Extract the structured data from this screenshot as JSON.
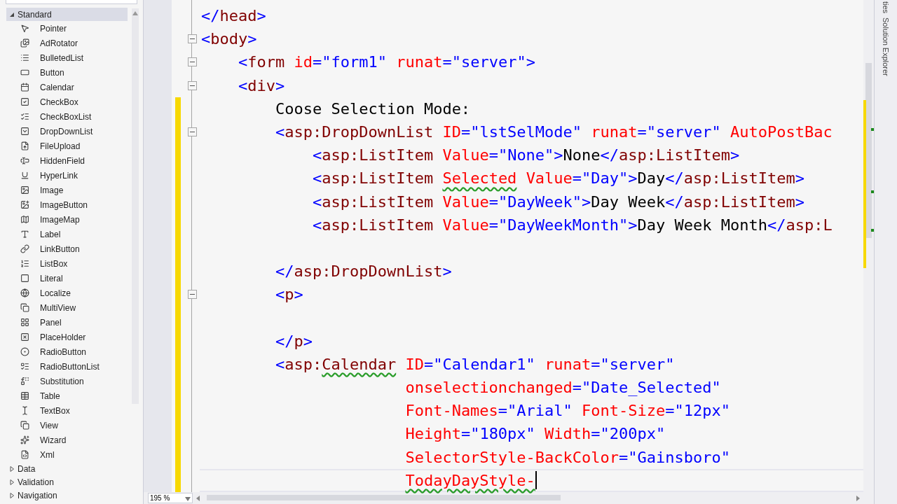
{
  "toolbox": {
    "groups": [
      {
        "label": "Standard",
        "expanded": true,
        "selected": true,
        "items": [
          "Pointer",
          "AdRotator",
          "BulletedList",
          "Button",
          "Calendar",
          "CheckBox",
          "CheckBoxList",
          "DropDownList",
          "FileUpload",
          "HiddenField",
          "HyperLink",
          "Image",
          "ImageButton",
          "ImageMap",
          "Label",
          "LinkButton",
          "ListBox",
          "Literal",
          "Localize",
          "MultiView",
          "Panel",
          "PlaceHolder",
          "RadioButton",
          "RadioButtonList",
          "Substitution",
          "Table",
          "TextBox",
          "View",
          "Wizard",
          "Xml"
        ]
      },
      {
        "label": "Data",
        "expanded": false,
        "selected": false
      },
      {
        "label": "Validation",
        "expanded": false,
        "selected": false
      },
      {
        "label": "Navigation",
        "expanded": false,
        "selected": false
      }
    ]
  },
  "editor": {
    "zoom": "195 %",
    "lines": [
      {
        "foldable": false,
        "modified": false,
        "tokens": [
          {
            "kind": "delimiter",
            "text": "</"
          },
          {
            "kind": "element",
            "text": "head"
          },
          {
            "kind": "delimiter",
            "text": ">"
          }
        ]
      },
      {
        "foldable": true,
        "modified": false,
        "tokens": [
          {
            "kind": "delimiter",
            "text": "<"
          },
          {
            "kind": "element",
            "text": "body"
          },
          {
            "kind": "delimiter",
            "text": ">"
          }
        ]
      },
      {
        "foldable": true,
        "modified": false,
        "tokens": [
          {
            "kind": "delimiter",
            "text": "    <"
          },
          {
            "kind": "element",
            "text": "form"
          },
          {
            "kind": "attribute",
            "text": " id"
          },
          {
            "kind": "value",
            "text": "=\"form1\""
          },
          {
            "kind": "attribute",
            "text": " runat"
          },
          {
            "kind": "value",
            "text": "=\"server\""
          },
          {
            "kind": "delimiter",
            "text": ">"
          }
        ]
      },
      {
        "foldable": true,
        "modified": false,
        "tokens": [
          {
            "kind": "delimiter",
            "text": "    <"
          },
          {
            "kind": "element",
            "text": "div"
          },
          {
            "kind": "delimiter",
            "text": ">"
          }
        ]
      },
      {
        "foldable": false,
        "modified": true,
        "tokens": [
          {
            "kind": "text",
            "text": "        Coose Selection Mode:"
          }
        ]
      },
      {
        "foldable": true,
        "modified": true,
        "tokens": [
          {
            "kind": "delimiter",
            "text": "        <"
          },
          {
            "kind": "element",
            "text": "asp:DropDownList"
          },
          {
            "kind": "attribute",
            "text": " ID"
          },
          {
            "kind": "value",
            "text": "=\"lstSelMode\""
          },
          {
            "kind": "attribute",
            "text": " runat"
          },
          {
            "kind": "value",
            "text": "=\"server\""
          },
          {
            "kind": "attribute",
            "text": " AutoPostBac"
          }
        ]
      },
      {
        "foldable": false,
        "modified": true,
        "tokens": [
          {
            "kind": "delimiter",
            "text": "            <"
          },
          {
            "kind": "element",
            "text": "asp:ListItem"
          },
          {
            "kind": "attribute",
            "text": " Value"
          },
          {
            "kind": "value",
            "text": "=\"None\""
          },
          {
            "kind": "delimiter",
            "text": ">"
          },
          {
            "kind": "text",
            "text": "None"
          },
          {
            "kind": "delimiter",
            "text": "</"
          },
          {
            "kind": "element",
            "text": "asp:ListItem"
          },
          {
            "kind": "delimiter",
            "text": ">"
          }
        ]
      },
      {
        "foldable": false,
        "modified": true,
        "tokens": [
          {
            "kind": "delimiter",
            "text": "            <"
          },
          {
            "kind": "element",
            "text": "asp:ListItem"
          },
          {
            "kind": "attribute",
            "text": " Selected",
            "squiggle": true
          },
          {
            "kind": "attribute",
            "text": " Value"
          },
          {
            "kind": "value",
            "text": "=\"Day\""
          },
          {
            "kind": "delimiter",
            "text": ">"
          },
          {
            "kind": "text",
            "text": "Day"
          },
          {
            "kind": "delimiter",
            "text": "</"
          },
          {
            "kind": "element",
            "text": "asp:ListItem"
          },
          {
            "kind": "delimiter",
            "text": ">"
          }
        ]
      },
      {
        "foldable": false,
        "modified": true,
        "tokens": [
          {
            "kind": "delimiter",
            "text": "            <"
          },
          {
            "kind": "element",
            "text": "asp:ListItem"
          },
          {
            "kind": "attribute",
            "text": " Value"
          },
          {
            "kind": "value",
            "text": "=\"DayWeek\""
          },
          {
            "kind": "delimiter",
            "text": ">"
          },
          {
            "kind": "text",
            "text": "Day Week"
          },
          {
            "kind": "delimiter",
            "text": "</"
          },
          {
            "kind": "element",
            "text": "asp:ListItem"
          },
          {
            "kind": "delimiter",
            "text": ">"
          }
        ]
      },
      {
        "foldable": false,
        "modified": true,
        "tokens": [
          {
            "kind": "delimiter",
            "text": "            <"
          },
          {
            "kind": "element",
            "text": "asp:ListItem"
          },
          {
            "kind": "attribute",
            "text": " Value"
          },
          {
            "kind": "value",
            "text": "=\"DayWeekMonth\""
          },
          {
            "kind": "delimiter",
            "text": ">"
          },
          {
            "kind": "text",
            "text": "Day Week Month"
          },
          {
            "kind": "delimiter",
            "text": "</"
          },
          {
            "kind": "element",
            "text": "asp:L"
          }
        ]
      },
      {
        "foldable": false,
        "modified": true
      },
      {
        "foldable": false,
        "modified": true,
        "tokens": [
          {
            "kind": "delimiter",
            "text": "        </"
          },
          {
            "kind": "element",
            "text": "asp:DropDownList"
          },
          {
            "kind": "delimiter",
            "text": ">"
          }
        ]
      },
      {
        "foldable": true,
        "modified": true,
        "tokens": [
          {
            "kind": "delimiter",
            "text": "        <"
          },
          {
            "kind": "element",
            "text": "p"
          },
          {
            "kind": "delimiter",
            "text": ">"
          }
        ]
      },
      {
        "foldable": false,
        "modified": true
      },
      {
        "foldable": false,
        "modified": true,
        "tokens": [
          {
            "kind": "delimiter",
            "text": "        </"
          },
          {
            "kind": "element",
            "text": "p"
          },
          {
            "kind": "delimiter",
            "text": ">"
          }
        ]
      },
      {
        "foldable": false,
        "modified": true,
        "tokens": [
          {
            "kind": "delimiter",
            "text": "        <"
          },
          {
            "kind": "element",
            "text": "asp:"
          },
          {
            "kind": "element",
            "text": "Calendar",
            "squiggle": true
          },
          {
            "kind": "attribute",
            "text": " ID"
          },
          {
            "kind": "value",
            "text": "=\"Calendar1\""
          },
          {
            "kind": "attribute",
            "text": " runat"
          },
          {
            "kind": "value",
            "text": "=\"server\""
          }
        ]
      },
      {
        "foldable": false,
        "modified": true,
        "tokens": [
          {
            "kind": "attribute",
            "text": "                      onselectionchanged"
          },
          {
            "kind": "value",
            "text": "=\"Date_Selected\""
          }
        ]
      },
      {
        "foldable": false,
        "modified": true,
        "tokens": [
          {
            "kind": "attribute",
            "text": "                      Font-Names"
          },
          {
            "kind": "value",
            "text": "=\"Arial\""
          },
          {
            "kind": "attribute",
            "text": " Font-Size"
          },
          {
            "kind": "value",
            "text": "=\"12px\""
          }
        ]
      },
      {
        "foldable": false,
        "modified": true,
        "tokens": [
          {
            "kind": "attribute",
            "text": "                      Height"
          },
          {
            "kind": "value",
            "text": "=\"180px\""
          },
          {
            "kind": "attribute",
            "text": " Width"
          },
          {
            "kind": "value",
            "text": "=\"200px\""
          }
        ]
      },
      {
        "foldable": false,
        "modified": true,
        "tokens": [
          {
            "kind": "attribute",
            "text": "                      SelectorStyle-BackColor"
          },
          {
            "kind": "value",
            "text": "=\"Gainsboro\""
          }
        ]
      },
      {
        "foldable": false,
        "modified": true,
        "current": true,
        "tokens": [
          {
            "kind": "attribute",
            "text": "                      TodayDayStyle-",
            "squiggle": true
          }
        ]
      }
    ]
  },
  "side_tabs": [
    "ties",
    "Solution Explorer"
  ]
}
